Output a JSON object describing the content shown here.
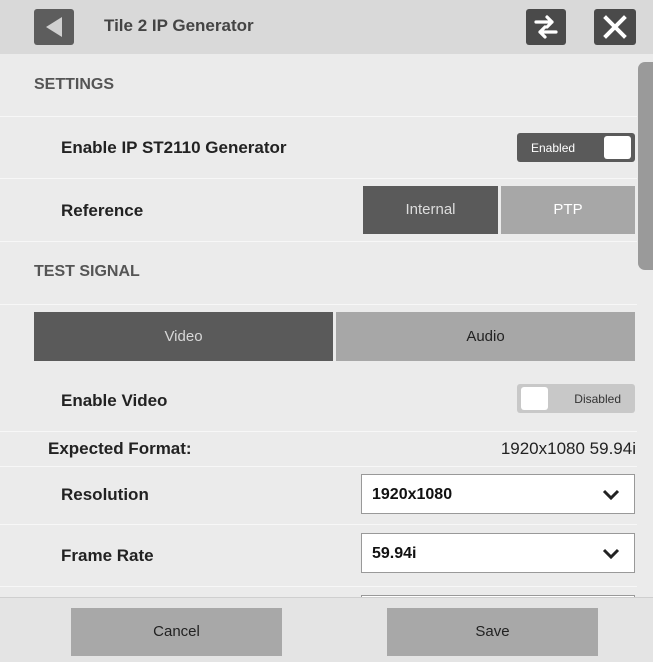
{
  "titlebar": {
    "title": "Tile 2 IP Generator"
  },
  "settings": {
    "header": "SETTINGS",
    "enable_generator": {
      "label": "Enable IP ST2110 Generator",
      "state": "Enabled"
    },
    "reference": {
      "label": "Reference",
      "options": [
        "Internal",
        "PTP"
      ],
      "selected": "Internal"
    }
  },
  "test_signal": {
    "header": "TEST SIGNAL",
    "tabs": [
      "Video",
      "Audio"
    ],
    "active_tab": "Video",
    "enable_video": {
      "label": "Enable Video",
      "state": "Disabled"
    },
    "expected_format": {
      "label": "Expected Format:",
      "value": "1920x1080 59.94i"
    },
    "resolution": {
      "label": "Resolution",
      "value": "1920x1080"
    },
    "frame_rate": {
      "label": "Frame Rate",
      "value": "59.94i"
    }
  },
  "footer": {
    "cancel": "Cancel",
    "save": "Save"
  },
  "icons": {
    "back": "back-arrow-icon",
    "swap": "swap-icon",
    "close": "close-icon",
    "dropdown": "chevron-down-icon"
  },
  "colors": {
    "accent_dark": "#5a5a5a",
    "inactive": "#a7a7a7",
    "background": "#ebebeb"
  }
}
